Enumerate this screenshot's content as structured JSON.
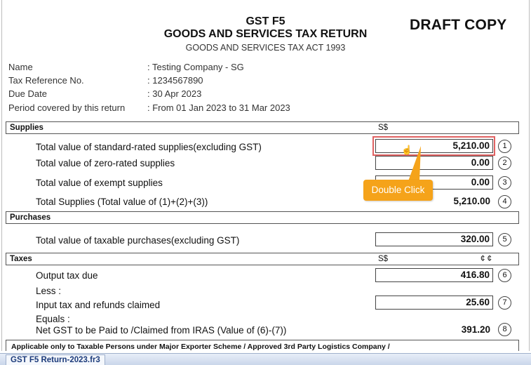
{
  "header": {
    "form": "GST F5",
    "title": "GOODS AND SERVICES TAX RETURN",
    "act": "GOODS AND SERVICES TAX ACT 1993",
    "stamp": "DRAFT COPY"
  },
  "info": [
    {
      "label": "Name",
      "value": ": Testing Company - SG"
    },
    {
      "label": "Tax Reference No.",
      "value": ": 1234567890"
    },
    {
      "label": "Due Date",
      "value": ": 30 Apr 2023"
    },
    {
      "label": "Period covered by this return",
      "value": ": From 01 Jan 2023 to 31 Mar 2023"
    }
  ],
  "supplies": {
    "title": "Supplies",
    "currency": "S$",
    "rows": [
      {
        "label": "Total value of standard-rated supplies(excluding GST)",
        "value": "5,210.00",
        "num": "1"
      },
      {
        "label": "Total value of zero-rated supplies",
        "value": "0.00",
        "num": "2"
      },
      {
        "label": "Total value of exempt supplies",
        "value": "0.00",
        "num": "3"
      },
      {
        "label": "Total Supplies (Total value of (1)+(2)+(3))",
        "value": "5,210.00",
        "num": "4"
      }
    ]
  },
  "purchases": {
    "title": "Purchases",
    "rows": [
      {
        "label": "Total value of taxable purchases(excluding GST)",
        "value": "320.00",
        "num": "5"
      }
    ]
  },
  "taxes": {
    "title": "Taxes",
    "currency": "S$",
    "cents": "¢ ¢",
    "output_label": "Output tax due",
    "output_value": "416.80",
    "output_num": "6",
    "less": "Less :",
    "input_label": "Input tax and refunds claimed",
    "input_value": "25.60",
    "input_num": "7",
    "equals": "Equals :",
    "net_label": "Net GST to be Paid to /Claimed from IRAS (Value of (6)-(7))",
    "net_value": "391.20",
    "net_num": "8"
  },
  "footer_note": "Applicable only to Taxable Persons under Major Exporter Scheme / Approved 3rd Party Logistics Company /",
  "callout": "Double Click",
  "tab": "GST F5 Return-2023.fr3",
  "colors": {
    "callout": "#f5a31a",
    "highlight": "#e06262",
    "tab_text": "#1b3a7a"
  }
}
